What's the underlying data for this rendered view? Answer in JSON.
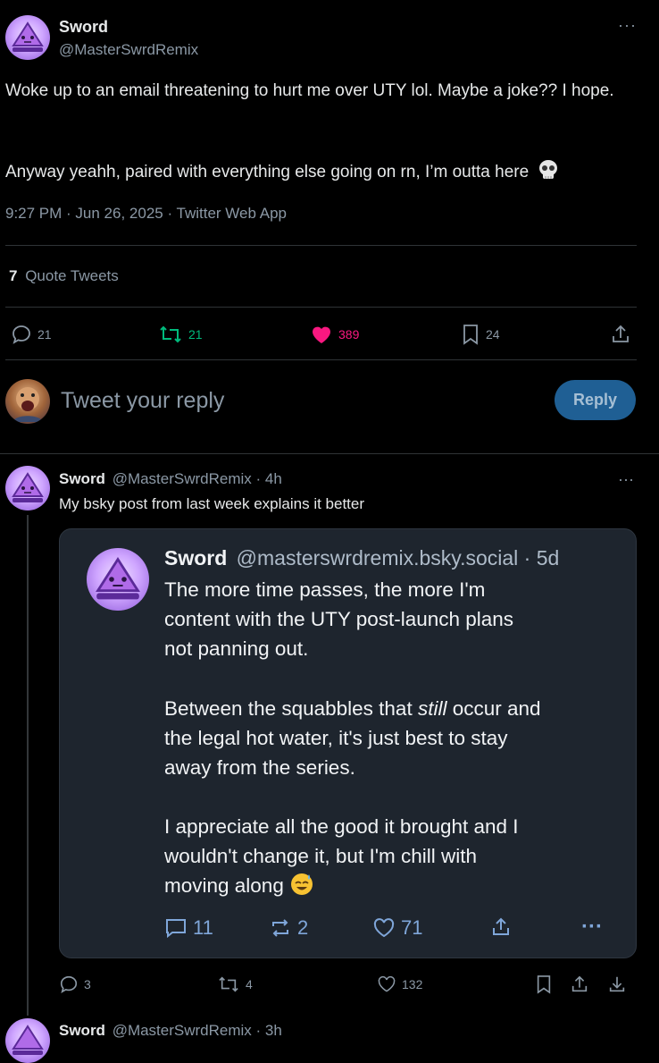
{
  "main_tweet": {
    "author": "Sword",
    "handle": "@MasterSwrdRemix",
    "text1": "Woke up to an email threatening to hurt me over UTY lol. Maybe a joke?? I hope.",
    "text2": "Anyway yeahh, paired with everything else going on rn, I’m outta here",
    "meta": "9:27 PM · Jun 26, 2025 · Twitter Web App",
    "quote_count": "7",
    "quote_label": "Quote Tweets",
    "stats": {
      "replies": "21",
      "retweets": "21",
      "likes": "389",
      "bookmarks": "24"
    }
  },
  "compose": {
    "placeholder": "Tweet your reply",
    "button": "Reply"
  },
  "reply_tweet": {
    "author": "Sword",
    "handle_time": "@MasterSwrdRemix · 4h",
    "text": "My bsky post from last week explains it better",
    "stats": {
      "replies": "3",
      "retweets": "4",
      "likes": "132"
    }
  },
  "bsky_card": {
    "author": "Sword",
    "handle": "@masterswrdremix.bsky.social",
    "time": "· 5d",
    "p1": "The more time passes, the more I'm\ncontent with the UTY post-launch plans\nnot panning out.",
    "p2a": "Between the squabbles that ",
    "p2_em": "still",
    "p2b": " occur and\nthe legal hot water, it's just best to stay\naway from the series.",
    "p3": "I appreciate all the good it brought and I\nwouldn't change it, but I'm chill with\nmoving along",
    "stats": {
      "replies": "11",
      "reposts": "2",
      "likes": "71"
    }
  },
  "next_tweet": {
    "author": "Sword",
    "handle_time": "@MasterSwrdRemix · 3h"
  },
  "colors": {
    "like_pink": "#f91880",
    "retweet_green": "#00ba7c",
    "reply_blue": "#1f5f94"
  }
}
